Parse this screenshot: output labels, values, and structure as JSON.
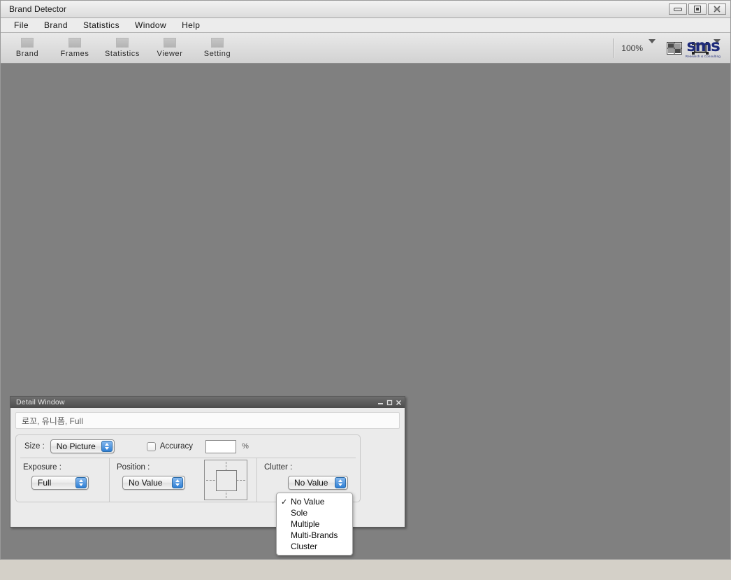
{
  "window": {
    "title": "Brand Detector",
    "buttons": [
      {
        "name": "minimize",
        "glyph": "minimize-icon"
      },
      {
        "name": "maximize",
        "glyph": "maximize-icon"
      },
      {
        "name": "close",
        "glyph": "close-icon"
      }
    ]
  },
  "menubar": {
    "items": [
      {
        "label": "File"
      },
      {
        "label": "Brand"
      },
      {
        "label": "Statistics"
      },
      {
        "label": "Window"
      },
      {
        "label": "Help"
      }
    ]
  },
  "toolbar": {
    "buttons": [
      {
        "label": "Brand",
        "icon": "brand-icon"
      },
      {
        "label": "Frames",
        "icon": "frames-icon"
      },
      {
        "label": "Statistics",
        "icon": "statistics-icon"
      },
      {
        "label": "Viewer",
        "icon": "viewer-icon"
      },
      {
        "label": "Setting",
        "icon": "setting-icon"
      }
    ],
    "zoom_level": "100%",
    "grid_icon": "grid-layout-icon",
    "screen_icon": "single-view-icon",
    "logo": {
      "main": "sms",
      "sub": "Research & Consulting"
    }
  },
  "canvas": {
    "background": "#808080"
  },
  "detail_window": {
    "title": "Detail Window",
    "buttons": [
      {
        "name": "minimize",
        "glyph": "minimize-icon"
      },
      {
        "name": "maximize",
        "glyph": "maximize-icon"
      },
      {
        "name": "close",
        "glyph": "close-icon"
      }
    ],
    "summary_text": "로꼬, 유니폼, Full",
    "size": {
      "label": "Size :",
      "value": "No Picture"
    },
    "accuracy": {
      "label": "Accuracy",
      "checked": false,
      "value": "",
      "unit": "%"
    },
    "exposure": {
      "label": "Exposure :",
      "value": "Full"
    },
    "position": {
      "label": "Position :",
      "value": "No Value",
      "diagram": "position-grid-icon"
    },
    "clutter": {
      "label": "Clutter :",
      "value": "No Value"
    }
  },
  "clutter_menu": {
    "selected": "No Value",
    "check_glyph": "✓",
    "options": [
      {
        "label": "No Value",
        "checked": true
      },
      {
        "label": "Sole",
        "checked": false
      },
      {
        "label": "Multiple",
        "checked": false
      },
      {
        "label": "Multi-Brands",
        "checked": false
      },
      {
        "label": "Cluster",
        "checked": false
      }
    ]
  },
  "colors": {
    "accent": "#2f7fd4",
    "brand": "#1d2a7a",
    "canvas": "#808080",
    "chrome": "#d8d8d8"
  }
}
